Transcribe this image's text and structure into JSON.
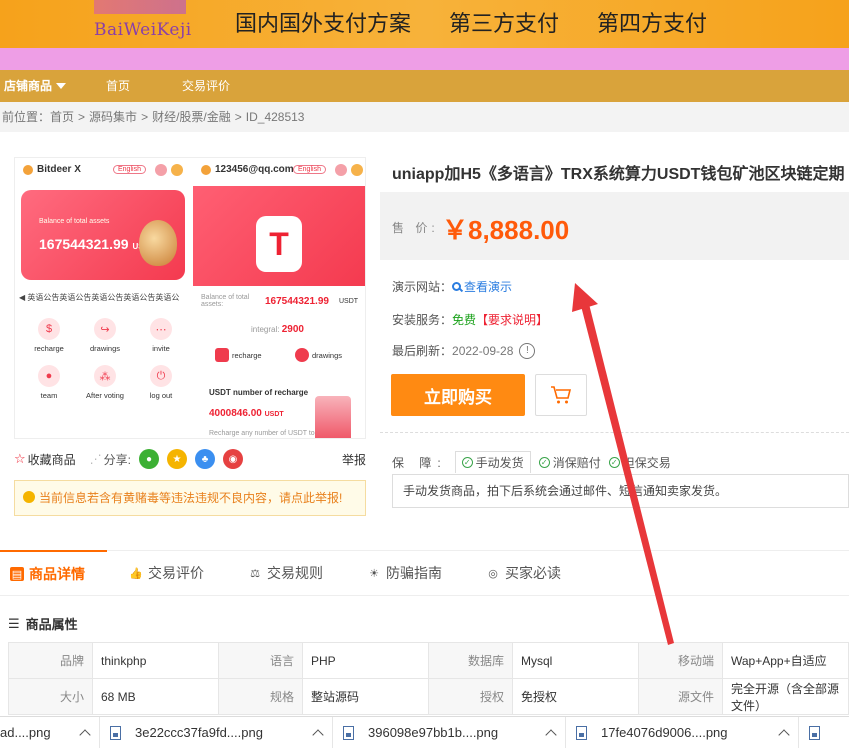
{
  "banner": {
    "logo_text": "BaiWeiKeji",
    "slogans": [
      "国内国外支付方案",
      "第三方支付",
      "第四方支付"
    ]
  },
  "nav": {
    "items": [
      "店铺商品",
      "首页",
      "交易评价"
    ]
  },
  "breadcrumb": {
    "prefix": "前位置：",
    "items": [
      "首页",
      "源码集市",
      "财经/股票/金融",
      "ID_428513"
    ]
  },
  "preview": {
    "left": {
      "app_name": "Bitdeer X",
      "lang": "English",
      "card_caption": "Balance of total assets",
      "card_amount": "167544321.99",
      "card_unit": "USDT",
      "ticker": "英语公告英语公告英语公告英语公告英语公",
      "icons": [
        "recharge",
        "drawings",
        "invite",
        "team",
        "After voting",
        "log out"
      ]
    },
    "right": {
      "account": "123456@qq.com",
      "lang": "English",
      "balance_caption": "Balance of total assets:",
      "balance_amount": "167544321.99",
      "balance_unit": "USDT",
      "integral_label": "integral:",
      "integral_value": "2900",
      "btn_recharge": "recharge",
      "btn_drawings": "drawings",
      "usdt_title": "USDT number of recharge",
      "usdt_amount": "4000846.00",
      "usdt_unit": "USDT",
      "usdt_sub": "Recharge any number of USDT to"
    }
  },
  "actions": {
    "favorite": "收藏商品",
    "share": "分享:",
    "report": "举报"
  },
  "warning": "当前信息若含有黄赌毒等违法违规不良内容，请点此举报!",
  "product": {
    "title": "uniapp加H5《多语言》TRX系统算力USDT钱包矿池区块链定期",
    "price_label": "售 价:",
    "price": "￥8,888.00",
    "demo_label": "演示网站：",
    "demo_link": "查看演示",
    "install_label": "安装服务：",
    "install_free": "免费",
    "install_req": "【要求说明】",
    "refresh_label": "最后刷新：",
    "refresh_date": "2022-09-28",
    "buy_button": "立即购买",
    "guarantee_label": "保 障:",
    "guarantees": [
      "手动发货",
      "消保赔付",
      "担保交易"
    ],
    "delivery_note": "手动发货商品，拍下后系统会通过邮件、短信通知卖家发货。"
  },
  "tabs": [
    "商品详情",
    "交易评价",
    "交易规则",
    "防骗指南",
    "买家必读"
  ],
  "attributes": {
    "title": "商品属性",
    "rows": [
      [
        [
          "品牌",
          "thinkphp"
        ],
        [
          "语言",
          "PHP"
        ],
        [
          "数据库",
          "Mysql"
        ],
        [
          "移动端",
          "Wap+App+自适应"
        ]
      ],
      [
        [
          "大小",
          "68 MB"
        ],
        [
          "规格",
          "整站源码"
        ],
        [
          "授权",
          "免授权"
        ],
        [
          "源文件",
          "完全开源（含全部源文件）"
        ]
      ]
    ]
  },
  "downloads": [
    "ad....png",
    "3e22ccc37fa9fd....png",
    "396098e97bb1b....png",
    "17fe4076d9006....png"
  ],
  "colors": {
    "accent": "#ff8a12",
    "price": "#ff5a0a",
    "nav": "#d9a33b",
    "arrow": "#e8373a"
  }
}
